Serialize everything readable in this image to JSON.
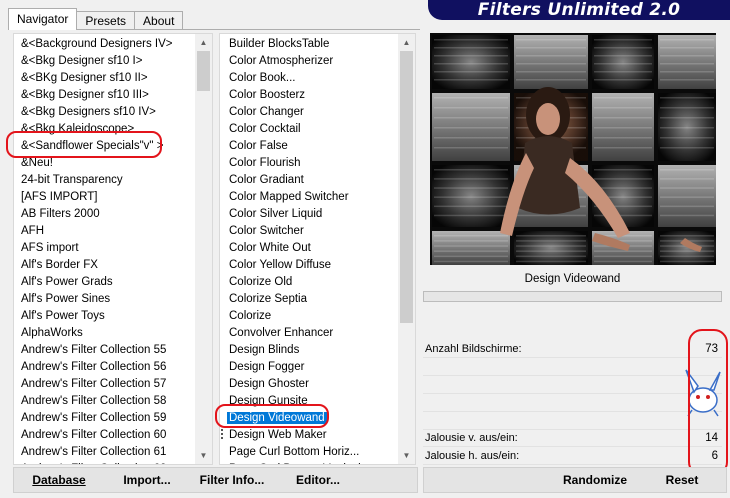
{
  "banner": {
    "title": "Filters Unlimited 2.0"
  },
  "tabs": [
    {
      "label": "Navigator",
      "active": true
    },
    {
      "label": "Presets",
      "active": false
    },
    {
      "label": "About",
      "active": false
    }
  ],
  "categories": {
    "items": [
      "&<Background Designers IV>",
      "&<Bkg Designer sf10 I>",
      "&<BKg Designer sf10 II>",
      "&<Bkg Designer sf10 III>",
      "&<Bkg Designers sf10 IV>",
      "&<Bkg Kaleidoscope>",
      "&<Sandflower Specials\"v\" >",
      "&Neu!",
      "24-bit Transparency",
      "[AFS IMPORT]",
      "AB Filters 2000",
      "AFH",
      "AFS import",
      "Alf's Border FX",
      "Alf's Power Grads",
      "Alf's Power Sines",
      "Alf's Power Toys",
      "AlphaWorks",
      "Andrew's Filter Collection 55",
      "Andrew's Filter Collection 56",
      "Andrew's Filter Collection 57",
      "Andrew's Filter Collection 58",
      "Andrew's Filter Collection 59",
      "Andrew's Filter Collection 60",
      "Andrew's Filter Collection 61",
      "Andrew's Filter Collection 62"
    ]
  },
  "filters": {
    "items": [
      "Builder BlocksTable",
      "Color Atmospherizer",
      "Color Book...",
      "Color Boosterz",
      "Color Changer",
      "Color Cocktail",
      "Color False",
      "Color Flourish",
      "Color Gradiant",
      "Color Mapped Switcher",
      "Color Silver Liquid",
      "Color Switcher",
      "Color White Out",
      "Color Yellow Diffuse",
      "Colorize Old",
      "Colorize Septia",
      "Colorize",
      "Convolver Enhancer",
      "Design Blinds",
      "Design Fogger",
      "Design Ghoster",
      "Design Gunsite",
      "Design Videowand",
      "Design Web Maker",
      "Page Curl Bottom Horiz...",
      "Page Curl Bottom Vertical"
    ],
    "selected": "Design Videowand"
  },
  "preview": {
    "filter_name": "Design Videowand"
  },
  "parameters": [
    {
      "label": "Anzahl Bildschirme:",
      "value": "73"
    },
    {
      "label": "",
      "value": ""
    },
    {
      "label": "",
      "value": ""
    },
    {
      "label": "",
      "value": ""
    },
    {
      "label": "",
      "value": ""
    },
    {
      "label": "Jalousie v. aus/ein:",
      "value": "14"
    },
    {
      "label": "Jalousie h. aus/ein:",
      "value": "6"
    }
  ],
  "buttons": {
    "database": "Database",
    "import": "Import...",
    "filter_info": "Filter Info...",
    "editor": "Editor...",
    "randomize": "Randomize",
    "reset": "Reset"
  },
  "colors": {
    "banner": "#101060",
    "selection": "#0078d7",
    "annotation": "#e3141b"
  }
}
